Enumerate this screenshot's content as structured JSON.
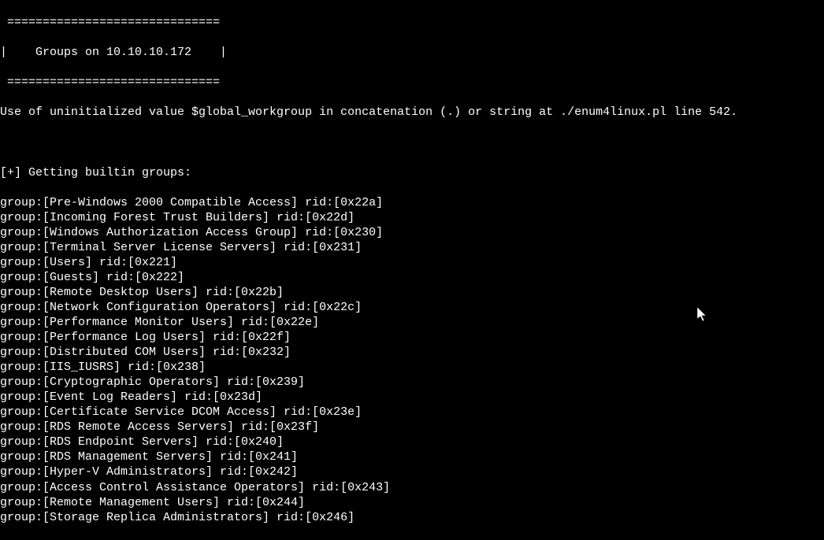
{
  "header": {
    "separator": " ============================== ",
    "title_line": "|    Groups on 10.10.10.172    |",
    "separator2": " ============================== "
  },
  "error_line": "Use of uninitialized value $global_workgroup in concatenation (.) or string at ./enum4linux.pl line 542.",
  "section_header": "[+] Getting builtin groups:",
  "groups": [
    {
      "name": "Pre-Windows 2000 Compatible Access",
      "rid": "0x22a"
    },
    {
      "name": "Incoming Forest Trust Builders",
      "rid": "0x22d"
    },
    {
      "name": "Windows Authorization Access Group",
      "rid": "0x230"
    },
    {
      "name": "Terminal Server License Servers",
      "rid": "0x231"
    },
    {
      "name": "Users",
      "rid": "0x221"
    },
    {
      "name": "Guests",
      "rid": "0x222"
    },
    {
      "name": "Remote Desktop Users",
      "rid": "0x22b"
    },
    {
      "name": "Network Configuration Operators",
      "rid": "0x22c"
    },
    {
      "name": "Performance Monitor Users",
      "rid": "0x22e"
    },
    {
      "name": "Performance Log Users",
      "rid": "0x22f"
    },
    {
      "name": "Distributed COM Users",
      "rid": "0x232"
    },
    {
      "name": "IIS_IUSRS",
      "rid": "0x238"
    },
    {
      "name": "Cryptographic Operators",
      "rid": "0x239"
    },
    {
      "name": "Event Log Readers",
      "rid": "0x23d"
    },
    {
      "name": "Certificate Service DCOM Access",
      "rid": "0x23e"
    },
    {
      "name": "RDS Remote Access Servers",
      "rid": "0x23f"
    },
    {
      "name": "RDS Endpoint Servers",
      "rid": "0x240"
    },
    {
      "name": "RDS Management Servers",
      "rid": "0x241"
    },
    {
      "name": "Hyper-V Administrators",
      "rid": "0x242"
    },
    {
      "name": "Access Control Assistance Operators",
      "rid": "0x243"
    },
    {
      "name": "Remote Management Users",
      "rid": "0x244"
    },
    {
      "name": "Storage Replica Administrators",
      "rid": "0x246"
    }
  ]
}
